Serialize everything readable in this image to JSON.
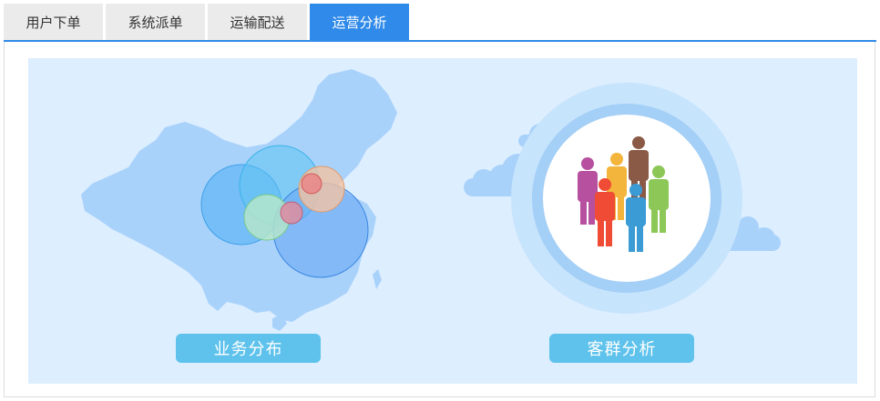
{
  "tabs": [
    {
      "label": "用户下单",
      "active": false
    },
    {
      "label": "系统派单",
      "active": false
    },
    {
      "label": "运输配送",
      "active": false
    },
    {
      "label": "运营分析",
      "active": true
    }
  ],
  "cards": {
    "business": {
      "label": "业务分布",
      "icon": "china-map-bubbles-icon"
    },
    "customer": {
      "label": "客群分析",
      "icon": "people-group-icon"
    }
  },
  "colors": {
    "accent": "#2f8ae9",
    "stage_bg": "#ddeeff",
    "button": "#5ec2ec",
    "map": "#a9d2fb"
  }
}
